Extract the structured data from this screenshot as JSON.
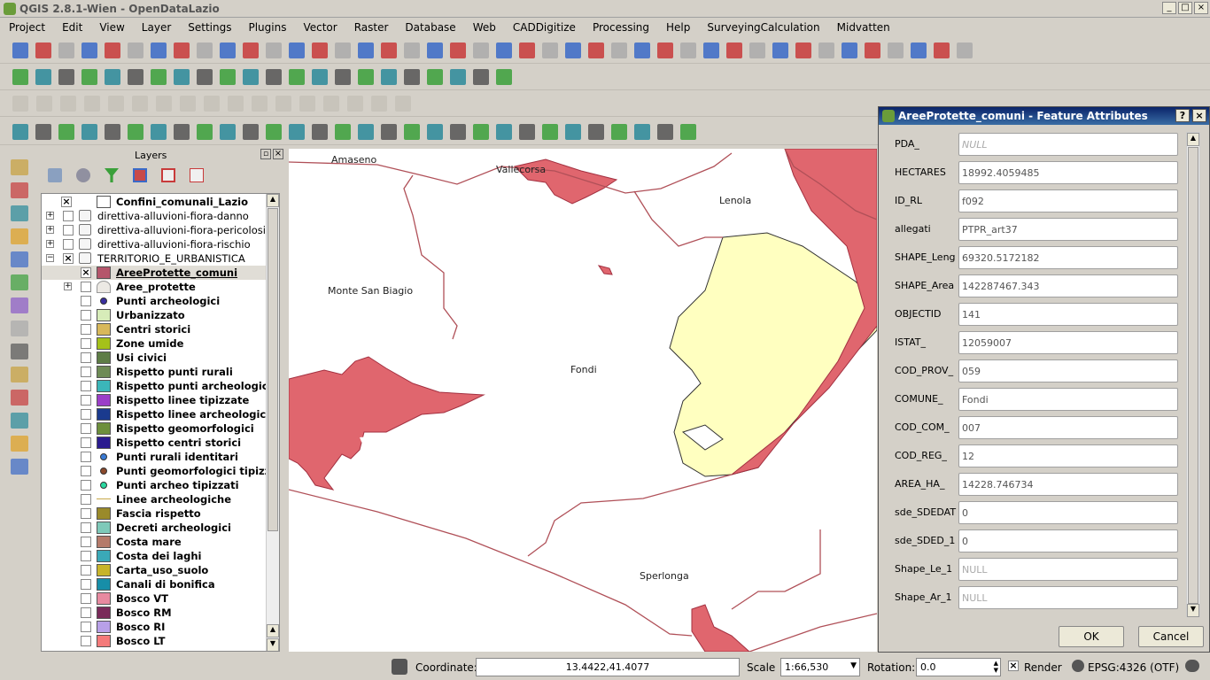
{
  "window": {
    "title": "QGIS 2.8.1-Wien - OpenDataLazio"
  },
  "menu": [
    "Project",
    "Edit",
    "View",
    "Layer",
    "Settings",
    "Plugins",
    "Vector",
    "Raster",
    "Database",
    "Web",
    "CADDigitize",
    "Processing",
    "Help",
    "SurveyingCalculation",
    "Midvatten"
  ],
  "layers_panel": {
    "title": "Layers",
    "items": [
      {
        "label": "Confini_comunali_Lazio",
        "bold": true,
        "checked": true,
        "level": 1,
        "swatch": "#ffffff",
        "kind": "box"
      },
      {
        "label": "direttiva-alluvioni-fiora-danno",
        "bold": false,
        "checked": false,
        "level": 0,
        "kind": "group"
      },
      {
        "label": "direttiva-alluvioni-fiora-pericolosita",
        "bold": false,
        "checked": false,
        "level": 0,
        "kind": "group"
      },
      {
        "label": "direttiva-alluvioni-fiora-rischio",
        "bold": false,
        "checked": false,
        "level": 0,
        "kind": "group"
      },
      {
        "label": "TERRITORIO_E_URBANISTICA",
        "bold": false,
        "checked": true,
        "level": 0,
        "kind": "group"
      },
      {
        "label": "AreeProtette_comuni",
        "bold": true,
        "checked": true,
        "level": 2,
        "swatch": "#b5566b",
        "kind": "box"
      },
      {
        "label": "Aree_protette",
        "bold": true,
        "checked": false,
        "level": 2,
        "swatch": "#ece9e4",
        "kind": "group2"
      },
      {
        "label": "Punti archeologici",
        "bold": true,
        "checked": false,
        "level": 2,
        "swatch": "#3a2fa0",
        "kind": "dot"
      },
      {
        "label": "Urbanizzato",
        "bold": true,
        "checked": false,
        "level": 2,
        "swatch": "#d7ecb9",
        "kind": "box"
      },
      {
        "label": "Centri storici",
        "bold": true,
        "checked": false,
        "level": 2,
        "swatch": "#d8b85a",
        "kind": "box"
      },
      {
        "label": "Zone umide",
        "bold": true,
        "checked": false,
        "level": 2,
        "swatch": "#a5c11a",
        "kind": "box"
      },
      {
        "label": "Usi civici",
        "bold": true,
        "checked": false,
        "level": 2,
        "swatch": "#5e7d46",
        "kind": "box"
      },
      {
        "label": "Rispetto punti rurali",
        "bold": true,
        "checked": false,
        "level": 2,
        "swatch": "#6e8b55",
        "kind": "box"
      },
      {
        "label": "Rispetto punti archeologici",
        "bold": true,
        "checked": false,
        "level": 2,
        "swatch": "#3bb6b9",
        "kind": "box"
      },
      {
        "label": "Rispetto linee tipizzate",
        "bold": true,
        "checked": false,
        "level": 2,
        "swatch": "#9b3ec8",
        "kind": "box"
      },
      {
        "label": "Rispetto linee archeologiche",
        "bold": true,
        "checked": false,
        "level": 2,
        "swatch": "#1a3a8e",
        "kind": "box"
      },
      {
        "label": "Rispetto geomorfologici",
        "bold": true,
        "checked": false,
        "level": 2,
        "swatch": "#6d8f3c",
        "kind": "box"
      },
      {
        "label": "Rispetto centri storici",
        "bold": true,
        "checked": false,
        "level": 2,
        "swatch": "#2a1b8f",
        "kind": "box"
      },
      {
        "label": "Punti rurali identitari",
        "bold": true,
        "checked": false,
        "level": 2,
        "swatch": "#3a7bd5",
        "kind": "dot"
      },
      {
        "label": "Punti geomorfologici tipizzati",
        "bold": true,
        "checked": false,
        "level": 2,
        "swatch": "#8b4a2c",
        "kind": "dot"
      },
      {
        "label": "Punti archeo tipizzati",
        "bold": true,
        "checked": false,
        "level": 2,
        "swatch": "#2ad8a0",
        "kind": "dot"
      },
      {
        "label": "Linee archeologiche",
        "bold": true,
        "checked": false,
        "level": 2,
        "swatch": "#c8a84a",
        "kind": "line"
      },
      {
        "label": "Fascia rispetto",
        "bold": true,
        "checked": false,
        "level": 2,
        "swatch": "#9a8a2a",
        "kind": "box"
      },
      {
        "label": "Decreti archeologici",
        "bold": true,
        "checked": false,
        "level": 2,
        "swatch": "#7ec9b9",
        "kind": "box"
      },
      {
        "label": "Costa mare",
        "bold": true,
        "checked": false,
        "level": 2,
        "swatch": "#b57a6a",
        "kind": "box"
      },
      {
        "label": "Costa dei laghi",
        "bold": true,
        "checked": false,
        "level": 2,
        "swatch": "#3aa9b8",
        "kind": "box"
      },
      {
        "label": "Carta_uso_suolo",
        "bold": true,
        "checked": false,
        "level": 2,
        "swatch": "#c8b42a",
        "kind": "box"
      },
      {
        "label": "Canali di bonifica",
        "bold": true,
        "checked": false,
        "level": 2,
        "swatch": "#178ea8",
        "kind": "box"
      },
      {
        "label": "Bosco VT",
        "bold": true,
        "checked": false,
        "level": 2,
        "swatch": "#e88aa0",
        "kind": "box"
      },
      {
        "label": "Bosco RM",
        "bold": true,
        "checked": false,
        "level": 2,
        "swatch": "#7a2a5a",
        "kind": "box"
      },
      {
        "label": "Bosco RI",
        "bold": true,
        "checked": false,
        "level": 2,
        "swatch": "#b8a0e8",
        "kind": "box"
      },
      {
        "label": "Bosco LT",
        "bold": true,
        "checked": false,
        "level": 2,
        "swatch": "#f47a7a",
        "kind": "box"
      }
    ]
  },
  "map": {
    "labels": [
      {
        "t": "Amaseno"
      },
      {
        "t": "Vallecorsa"
      },
      {
        "t": "Lenola"
      },
      {
        "t": "Monte San Biagio"
      },
      {
        "t": "Fondi"
      },
      {
        "t": "Sperlonga"
      }
    ]
  },
  "dialog": {
    "title": "AreeProtette_comuni - Feature Attributes",
    "fields": [
      {
        "name": "PDA_",
        "value": "NULL",
        "null": true
      },
      {
        "name": "HECTARES",
        "value": "18992.4059485",
        "null": false
      },
      {
        "name": "ID_RL",
        "value": "f092",
        "null": false
      },
      {
        "name": "allegati",
        "value": "PTPR_art37",
        "null": false
      },
      {
        "name": "SHAPE_Leng",
        "value": "69320.5172182",
        "null": false
      },
      {
        "name": "SHAPE_Area",
        "value": "142287467.343",
        "null": false
      },
      {
        "name": "OBJECTID",
        "value": "141",
        "null": false
      },
      {
        "name": "ISTAT_",
        "value": "12059007",
        "null": false
      },
      {
        "name": "COD_PROV_",
        "value": "059",
        "null": false
      },
      {
        "name": "COMUNE_",
        "value": "Fondi",
        "null": false
      },
      {
        "name": "COD_COM_",
        "value": "007",
        "null": false
      },
      {
        "name": "COD_REG_",
        "value": "12",
        "null": false
      },
      {
        "name": "AREA_HA_",
        "value": "14228.746734",
        "null": false
      },
      {
        "name": "sde_SDEDAT",
        "value": "0",
        "null": false
      },
      {
        "name": "sde_SDED_1",
        "value": "0",
        "null": false
      },
      {
        "name": "Shape_Le_1",
        "value": "NULL",
        "null": true
      },
      {
        "name": "Shape_Ar_1",
        "value": "NULL",
        "null": true
      }
    ],
    "ok": "OK",
    "cancel": "Cancel"
  },
  "status": {
    "coord_label": "Coordinate:",
    "coord": "13.4422,41.4077",
    "scale_label": "Scale",
    "scale": "1:66,530",
    "rot_label": "Rotation:",
    "rotation": "0.0",
    "render": "Render",
    "crs": "EPSG:4326 (OTF)"
  }
}
